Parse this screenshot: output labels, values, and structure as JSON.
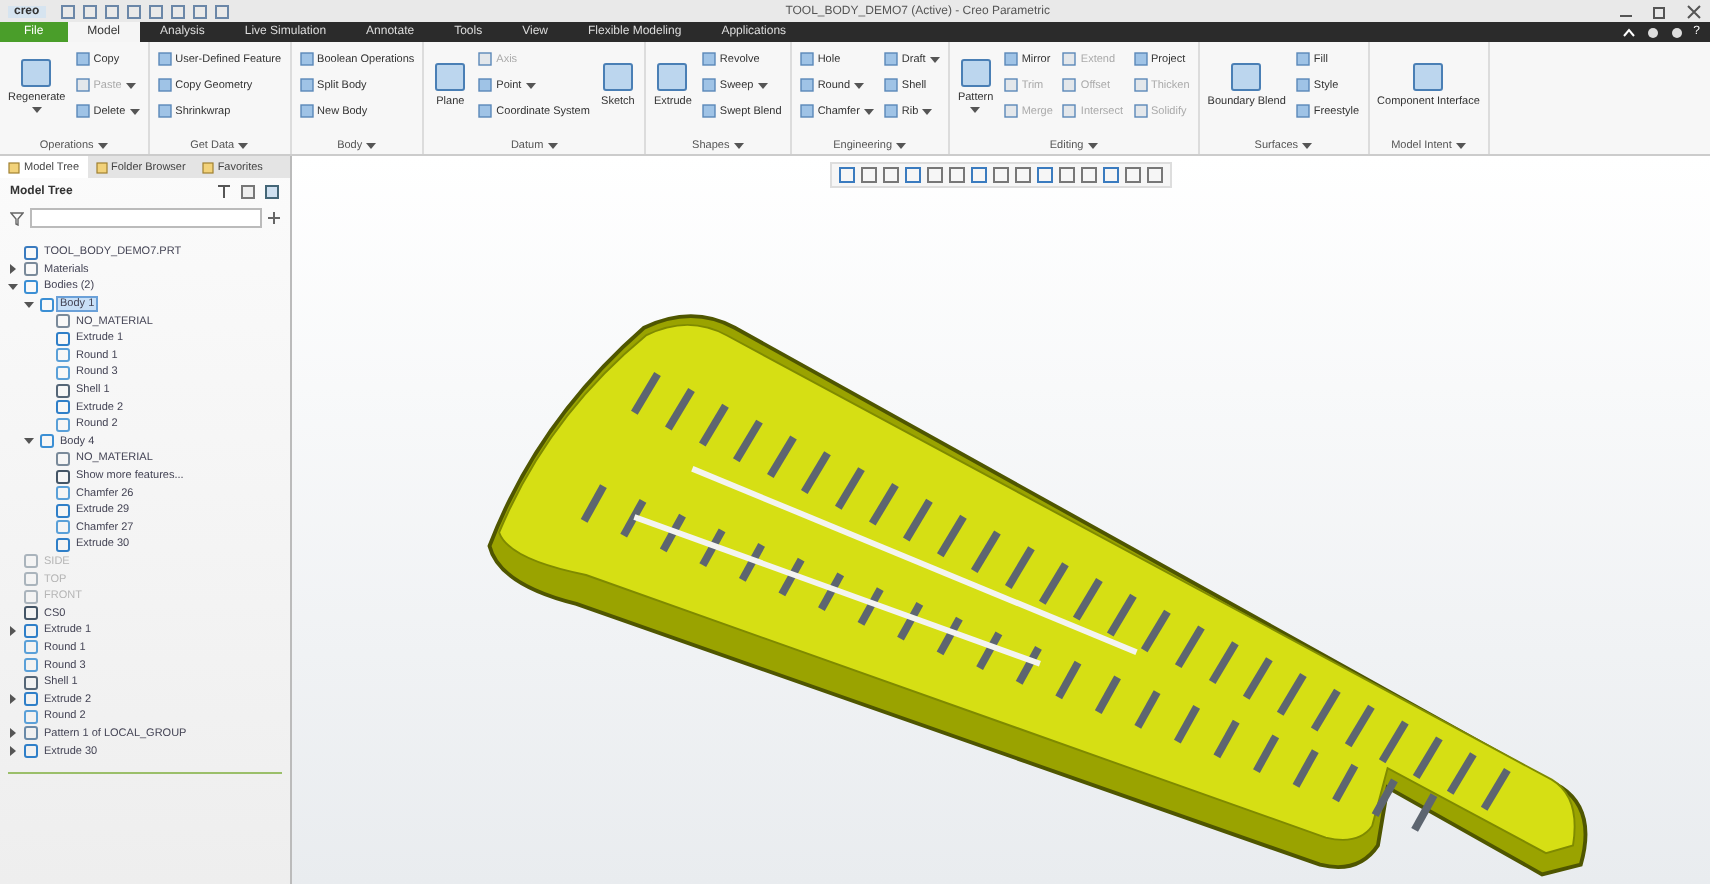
{
  "window": {
    "brand": "creo",
    "title": "TOOL_BODY_DEMO7 (Active) - Creo Parametric",
    "help": "?"
  },
  "menu_tabs": [
    {
      "label": "File",
      "kind": "file",
      "selected": false
    },
    {
      "label": "Model",
      "kind": "tab",
      "selected": true
    },
    {
      "label": "Analysis",
      "kind": "tab",
      "selected": false
    },
    {
      "label": "Live Simulation",
      "kind": "tab",
      "selected": false
    },
    {
      "label": "Annotate",
      "kind": "tab",
      "selected": false
    },
    {
      "label": "Tools",
      "kind": "tab",
      "selected": false
    },
    {
      "label": "View",
      "kind": "tab",
      "selected": false
    },
    {
      "label": "Flexible Modeling",
      "kind": "tab",
      "selected": false
    },
    {
      "label": "Applications",
      "kind": "tab",
      "selected": false
    }
  ],
  "ribbon": [
    {
      "label": "Operations",
      "items": [
        {
          "label": "Regenerate",
          "kind": "large",
          "disabled": false,
          "dropdown": true
        },
        {
          "label": "Copy",
          "kind": "small",
          "disabled": false,
          "dropdown": false
        },
        {
          "label": "Paste",
          "kind": "small",
          "disabled": true,
          "dropdown": true
        },
        {
          "label": "Delete",
          "kind": "small",
          "disabled": false,
          "dropdown": true
        }
      ]
    },
    {
      "label": "Get Data",
      "items": [
        {
          "label": "User-Defined Feature",
          "kind": "small",
          "disabled": false,
          "dropdown": false
        },
        {
          "label": "Copy Geometry",
          "kind": "small",
          "disabled": false,
          "dropdown": false
        },
        {
          "label": "Shrinkwrap",
          "kind": "small",
          "disabled": false,
          "dropdown": false
        }
      ]
    },
    {
      "label": "Body",
      "items": [
        {
          "label": "Boolean Operations",
          "kind": "small",
          "disabled": false,
          "dropdown": false
        },
        {
          "label": "Split Body",
          "kind": "small",
          "disabled": false,
          "dropdown": false
        },
        {
          "label": "New Body",
          "kind": "small",
          "disabled": false,
          "dropdown": false
        }
      ]
    },
    {
      "label": "Datum",
      "items": [
        {
          "label": "Plane",
          "kind": "large",
          "disabled": false,
          "dropdown": false
        },
        {
          "label": "Axis",
          "kind": "small",
          "disabled": true,
          "dropdown": false
        },
        {
          "label": "Point",
          "kind": "small",
          "disabled": false,
          "dropdown": true
        },
        {
          "label": "Coordinate System",
          "kind": "small",
          "disabled": false,
          "dropdown": false
        },
        {
          "label": "Sketch",
          "kind": "large",
          "disabled": false,
          "dropdown": false
        }
      ]
    },
    {
      "label": "Shapes",
      "items": [
        {
          "label": "Extrude",
          "kind": "large",
          "disabled": false,
          "dropdown": false
        },
        {
          "label": "Revolve",
          "kind": "small",
          "disabled": false,
          "dropdown": false
        },
        {
          "label": "Sweep",
          "kind": "small",
          "disabled": false,
          "dropdown": true
        },
        {
          "label": "Swept Blend",
          "kind": "small",
          "disabled": false,
          "dropdown": false
        }
      ]
    },
    {
      "label": "Engineering",
      "items": [
        {
          "label": "Hole",
          "kind": "small",
          "disabled": false,
          "dropdown": false
        },
        {
          "label": "Round",
          "kind": "small",
          "disabled": false,
          "dropdown": true
        },
        {
          "label": "Chamfer",
          "kind": "small",
          "disabled": false,
          "dropdown": true
        },
        {
          "label": "Draft",
          "kind": "small",
          "disabled": false,
          "dropdown": true
        },
        {
          "label": "Shell",
          "kind": "small",
          "disabled": false,
          "dropdown": false
        },
        {
          "label": "Rib",
          "kind": "small",
          "disabled": false,
          "dropdown": true
        }
      ]
    },
    {
      "label": "Editing",
      "items": [
        {
          "label": "Pattern",
          "kind": "large",
          "disabled": false,
          "dropdown": true
        },
        {
          "label": "Mirror",
          "kind": "small",
          "disabled": false,
          "dropdown": false
        },
        {
          "label": "Trim",
          "kind": "small",
          "disabled": true,
          "dropdown": false
        },
        {
          "label": "Merge",
          "kind": "small",
          "disabled": true,
          "dropdown": false
        },
        {
          "label": "Extend",
          "kind": "small",
          "disabled": true,
          "dropdown": false
        },
        {
          "label": "Offset",
          "kind": "small",
          "disabled": true,
          "dropdown": false
        },
        {
          "label": "Intersect",
          "kind": "small",
          "disabled": true,
          "dropdown": false
        },
        {
          "label": "Project",
          "kind": "small",
          "disabled": false,
          "dropdown": false
        },
        {
          "label": "Thicken",
          "kind": "small",
          "disabled": true,
          "dropdown": false
        },
        {
          "label": "Solidify",
          "kind": "small",
          "disabled": true,
          "dropdown": false
        }
      ]
    },
    {
      "label": "Surfaces",
      "items": [
        {
          "label": "Boundary Blend",
          "kind": "large",
          "disabled": false,
          "dropdown": false
        },
        {
          "label": "Fill",
          "kind": "small",
          "disabled": false,
          "dropdown": false
        },
        {
          "label": "Style",
          "kind": "small",
          "disabled": false,
          "dropdown": false
        },
        {
          "label": "Freestyle",
          "kind": "small",
          "disabled": false,
          "dropdown": false
        }
      ]
    },
    {
      "label": "Model Intent",
      "items": [
        {
          "label": "Component Interface",
          "kind": "large",
          "disabled": false,
          "dropdown": false
        }
      ]
    }
  ],
  "panel_tabs": [
    {
      "label": "Model Tree",
      "selected": true
    },
    {
      "label": "Folder Browser",
      "selected": false
    },
    {
      "label": "Favorites",
      "selected": false
    }
  ],
  "tree_header": "Model Tree",
  "tree": [
    {
      "label": "TOOL_BODY_DEMO7.PRT",
      "kind": "part",
      "selected": false,
      "disabled": false
    },
    {
      "label": "Materials",
      "kind": "material",
      "selected": false,
      "disabled": false,
      "expanded": false
    },
    {
      "label": "Bodies (2)",
      "kind": "body",
      "selected": false,
      "disabled": false,
      "expanded": true,
      "children": [
        {
          "label": "Body 1",
          "kind": "body",
          "selected": true,
          "disabled": false,
          "expanded": true,
          "children": [
            {
              "label": "NO_MATERIAL",
              "kind": "material",
              "selected": false,
              "disabled": false
            },
            {
              "label": "Extrude 1",
              "kind": "extrude",
              "selected": false,
              "disabled": false
            },
            {
              "label": "Round 1",
              "kind": "round",
              "selected": false,
              "disabled": false
            },
            {
              "label": "Round 3",
              "kind": "round",
              "selected": false,
              "disabled": false
            },
            {
              "label": "Shell 1",
              "kind": "shell",
              "selected": false,
              "disabled": false
            },
            {
              "label": "Extrude 2",
              "kind": "extrude",
              "selected": false,
              "disabled": false
            },
            {
              "label": "Round 2",
              "kind": "round",
              "selected": false,
              "disabled": false
            }
          ]
        },
        {
          "label": "Body 4",
          "kind": "body",
          "selected": false,
          "disabled": false,
          "expanded": true,
          "children": [
            {
              "label": "NO_MATERIAL",
              "kind": "material",
              "selected": false,
              "disabled": false
            },
            {
              "label": "Show more features...",
              "kind": "more",
              "selected": false,
              "disabled": false
            },
            {
              "label": "Chamfer 26",
              "kind": "round",
              "selected": false,
              "disabled": false
            },
            {
              "label": "Extrude 29",
              "kind": "extrude",
              "selected": false,
              "disabled": false
            },
            {
              "label": "Chamfer 27",
              "kind": "round",
              "selected": false,
              "disabled": false
            },
            {
              "label": "Extrude 30",
              "kind": "extrude",
              "selected": false,
              "disabled": false
            }
          ]
        }
      ]
    },
    {
      "label": "SIDE",
      "kind": "plane",
      "selected": false,
      "disabled": true
    },
    {
      "label": "TOP",
      "kind": "plane",
      "selected": false,
      "disabled": true
    },
    {
      "label": "FRONT",
      "kind": "plane",
      "selected": false,
      "disabled": true
    },
    {
      "label": "CS0",
      "kind": "csys",
      "selected": false,
      "disabled": false
    },
    {
      "label": "Extrude 1",
      "kind": "extrude",
      "selected": false,
      "disabled": false,
      "expanded": false
    },
    {
      "label": "Round 1",
      "kind": "round",
      "selected": false,
      "disabled": false
    },
    {
      "label": "Round 3",
      "kind": "round",
      "selected": false,
      "disabled": false
    },
    {
      "label": "Shell 1",
      "kind": "shell",
      "selected": false,
      "disabled": false
    },
    {
      "label": "Extrude 2",
      "kind": "extrude",
      "selected": false,
      "disabled": false,
      "expanded": false
    },
    {
      "label": "Round 2",
      "kind": "round",
      "selected": false,
      "disabled": false
    },
    {
      "label": "Pattern 1 of LOCAL_GROUP",
      "kind": "pattern",
      "selected": false,
      "disabled": false,
      "expanded": false
    },
    {
      "label": "Extrude 30",
      "kind": "extrude",
      "selected": false,
      "disabled": false,
      "expanded": false
    }
  ]
}
